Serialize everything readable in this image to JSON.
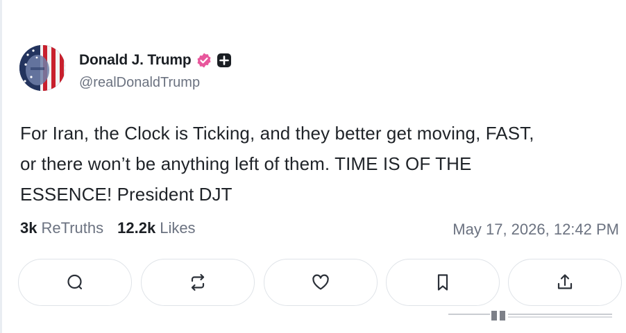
{
  "author": {
    "display_name": "Donald J. Trump",
    "handle": "@realDonaldTrump",
    "verified_color": "#e8579c",
    "badge_icon": "plus-badge-icon"
  },
  "post": {
    "lines": [
      "For Iran, the Clock is Ticking, and they better get moving, FAST,",
      "or there won’t be anything left of them. TIME IS OF THE",
      "ESSENCE! President DJT"
    ]
  },
  "stats": {
    "retruths_count": "3k",
    "retruths_label": "ReTruths",
    "likes_count": "12.2k",
    "likes_label": "Likes"
  },
  "timestamp": "May 17, 2026, 12:42 PM",
  "actions": [
    {
      "name": "reply",
      "icon": "comment-icon"
    },
    {
      "name": "retruth",
      "icon": "repost-icon"
    },
    {
      "name": "like",
      "icon": "heart-icon"
    },
    {
      "name": "bookmark",
      "icon": "bookmark-icon"
    },
    {
      "name": "share",
      "icon": "share-icon"
    }
  ]
}
